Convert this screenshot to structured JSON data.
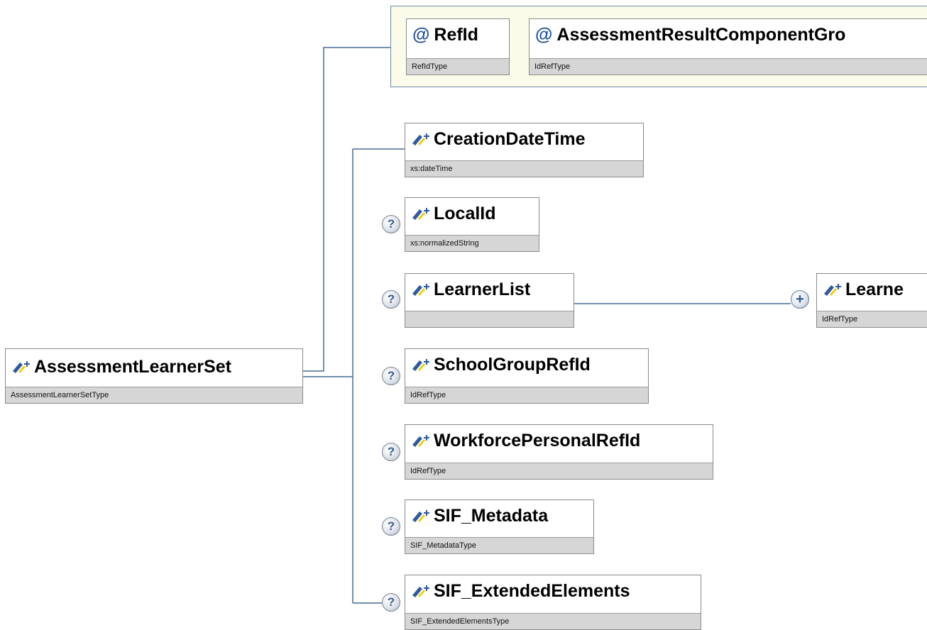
{
  "root": {
    "name": "AssessmentLearnerSet",
    "type": "AssessmentLearnerSetType"
  },
  "attributes": [
    {
      "name": "RefId",
      "type": "RefIdType"
    },
    {
      "name": "AssessmentResultComponentGro",
      "type": "IdRefType"
    }
  ],
  "elements": [
    {
      "name": "CreationDateTime",
      "type": "xs:dateTime",
      "optional": false
    },
    {
      "name": "LocalId",
      "type": "xs:normalizedString",
      "optional": true
    },
    {
      "name": "LearnerList",
      "type": "",
      "optional": true
    },
    {
      "name": "SchoolGroupRefId",
      "type": "IdRefType",
      "optional": true
    },
    {
      "name": "WorkforcePersonalRefId",
      "type": "IdRefType",
      "optional": true
    },
    {
      "name": "SIF_Metadata",
      "type": "SIF_MetadataType",
      "optional": true
    },
    {
      "name": "SIF_ExtendedElements",
      "type": "SIF_ExtendedElementsType",
      "optional": true
    }
  ],
  "learner_list_child": {
    "name": "Learne",
    "type": "IdRefType"
  },
  "symbols": {
    "optional": "?",
    "expand": "+",
    "attribute": "@"
  },
  "icons": {
    "element": "element-icon",
    "attribute": "at-icon",
    "optional": "question-mark-icon",
    "expand": "plus-icon"
  },
  "colors": {
    "connector": "#466a96",
    "attribute_group_bg": "#fbfbe9",
    "type_bar": "#d6d6d6",
    "icon_blue": "#2d5aa0",
    "icon_yellow": "#f2cc00"
  }
}
